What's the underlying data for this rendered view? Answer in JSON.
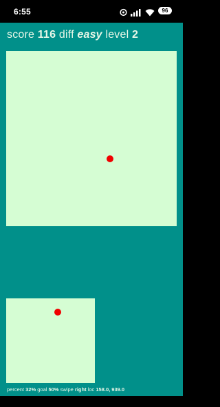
{
  "status_bar": {
    "time": "6:55",
    "battery": "96",
    "icons": [
      "data-saver-icon",
      "signal-icon",
      "wifi-icon",
      "battery-icon"
    ]
  },
  "hud": {
    "score_label": "score",
    "score_value": "116",
    "diff_label": "diff",
    "diff_value": "easy",
    "level_label": "level",
    "level_value": "2"
  },
  "footer": {
    "percent_label": "percent",
    "percent_value": "32%",
    "goal_label": "goal",
    "goal_value": "50%",
    "swipe_label": "swipe",
    "swipe_value": "right",
    "loc_label": "loc",
    "loc_value": "158.0, 939.0"
  },
  "colors": {
    "background": "#01908A",
    "board": "#D5FDD3",
    "dot": "#F00000",
    "text": "#E8F7E8"
  }
}
